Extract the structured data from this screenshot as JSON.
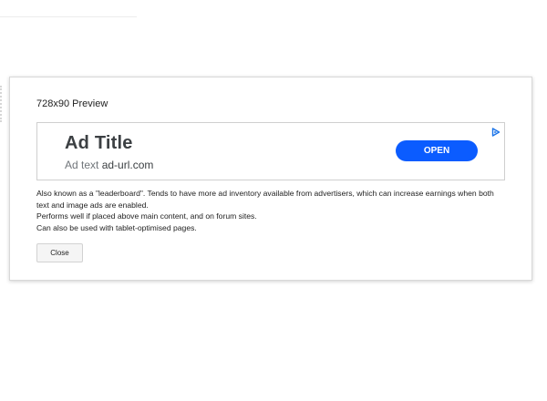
{
  "modal": {
    "title": "728x90 Preview",
    "ad": {
      "title": "Ad Title",
      "text_prefix": "Ad text",
      "url": "ad-url.com",
      "cta_label": "OPEN",
      "adchoices_icon": "adchoices-triangle-icon"
    },
    "description": [
      "Also known as a \"leaderboard\". Tends to have more ad inventory available from advertisers, which can increase earnings when both text and image ads are enabled.",
      "Performs well if placed above main content, and on forum sites.",
      "Can also be used with tablet-optimised pages."
    ],
    "close_label": "Close"
  },
  "colors": {
    "cta_background": "#0b5cff",
    "ad_title": "#3c4043",
    "ad_text": "#70757a",
    "adchoices": "#1a73e8"
  }
}
